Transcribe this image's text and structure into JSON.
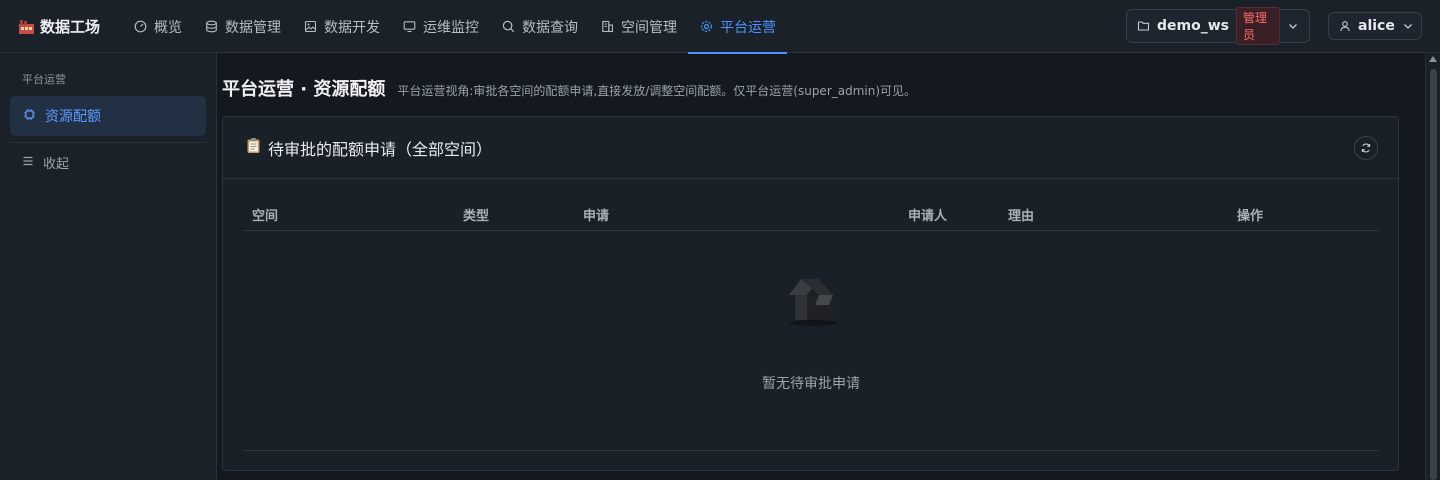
{
  "app": {
    "title": "数据工场"
  },
  "nav": [
    {
      "label": "概览",
      "icon": "gauge-icon"
    },
    {
      "label": "数据管理",
      "icon": "database-icon"
    },
    {
      "label": "数据开发",
      "icon": "image-icon"
    },
    {
      "label": "运维监控",
      "icon": "monitor-icon"
    },
    {
      "label": "数据查询",
      "icon": "search-icon"
    },
    {
      "label": "空间管理",
      "icon": "building-icon"
    },
    {
      "label": "平台运营",
      "icon": "gear-icon",
      "active": true
    }
  ],
  "workspace": {
    "name": "demo_ws",
    "role_badge": "管理员"
  },
  "user": {
    "name": "alice"
  },
  "sidebar": {
    "group_label": "平台运营",
    "items": [
      {
        "label": "资源配额",
        "icon": "cpu-icon",
        "active": true
      }
    ],
    "collapse_label": "收起"
  },
  "page": {
    "title": "平台运营 · 资源配额",
    "description": "平台运营视角:审批各空间的配额申请,直接发放/调整空间配额。仅平台运营(super_admin)可见。"
  },
  "card": {
    "title": "待审批的配额申请（全部空间）",
    "table": {
      "columns": [
        "空间",
        "类型",
        "申请",
        "申请人",
        "理由",
        "操作"
      ],
      "rows": [],
      "empty_text": "暂无待审批申请"
    }
  },
  "colors": {
    "accent": "#4d93ff",
    "badge": "#ff6b6b",
    "background": "#141920"
  }
}
